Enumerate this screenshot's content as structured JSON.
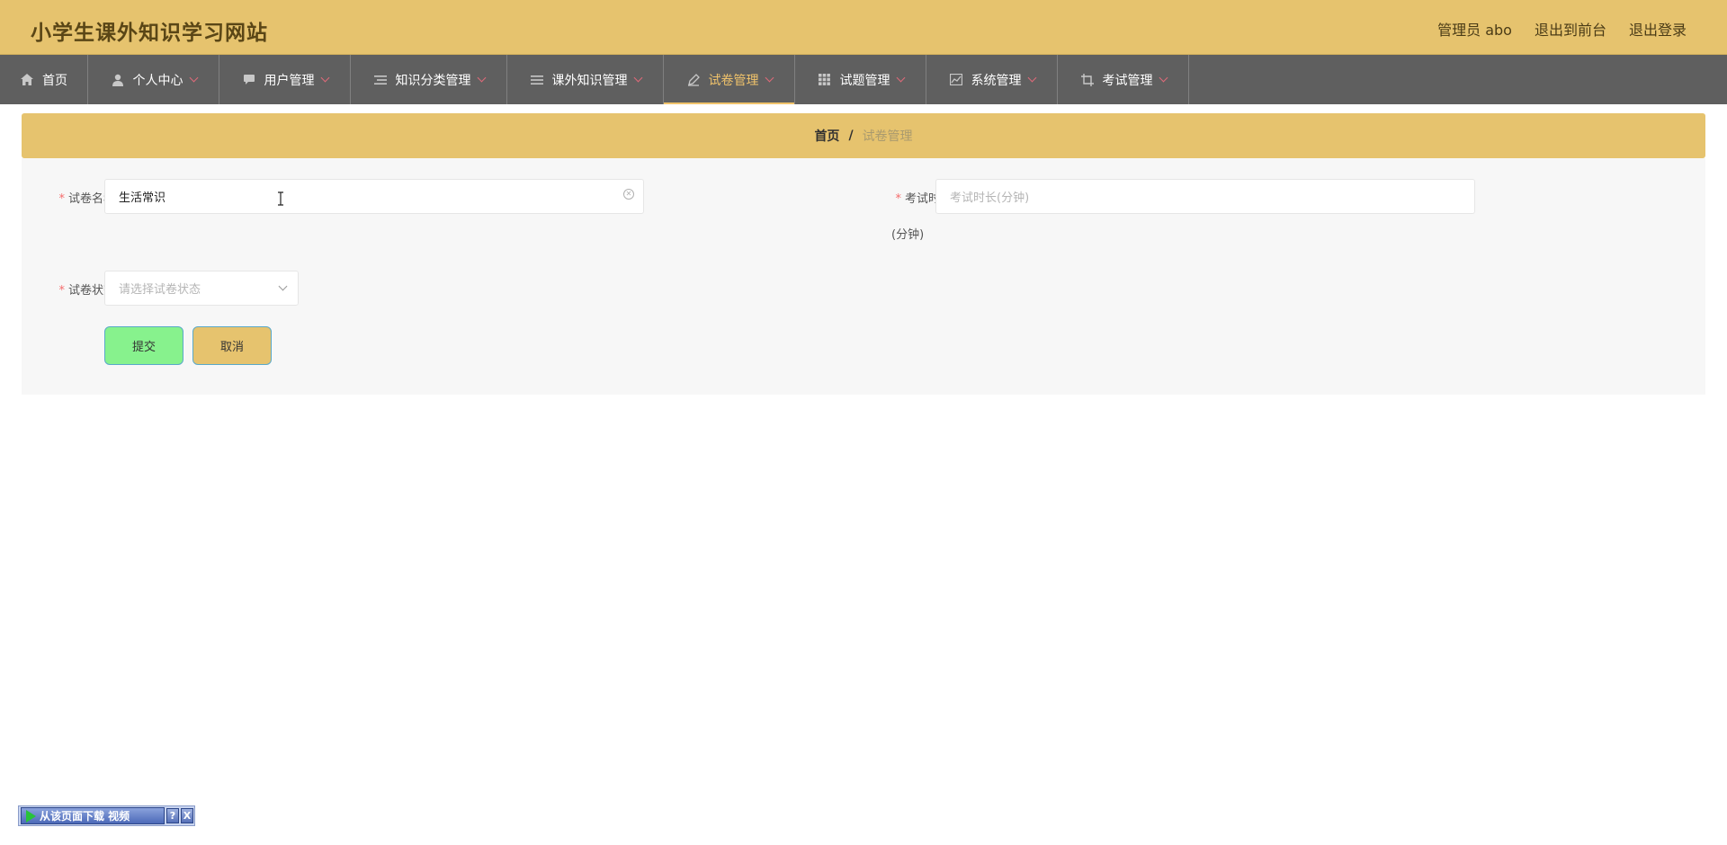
{
  "header": {
    "site_title": "小学生课外知识学习网站",
    "user_label": "管理员 abo",
    "back_front": "退出到前台",
    "logout": "退出登录"
  },
  "nav": {
    "items": [
      {
        "label": "首页",
        "icon": "home-icon"
      },
      {
        "label": "个人中心",
        "icon": "user-icon"
      },
      {
        "label": "用户管理",
        "icon": "chat-icon"
      },
      {
        "label": "知识分类管理",
        "icon": "list-icon"
      },
      {
        "label": "课外知识管理",
        "icon": "menu-icon"
      },
      {
        "label": "试卷管理",
        "icon": "pen-icon",
        "active": true
      },
      {
        "label": "试题管理",
        "icon": "grid-icon"
      },
      {
        "label": "系统管理",
        "icon": "chart-icon"
      },
      {
        "label": "考试管理",
        "icon": "crop-icon"
      }
    ]
  },
  "breadcrumb": {
    "home": "首页",
    "separator": "/",
    "current": "试卷管理"
  },
  "form": {
    "name_label": "试卷名称",
    "name_value": "生活常识",
    "duration_label": "考试时长",
    "duration_placeholder": "考试时长(分钟)",
    "duration_unit": "(分钟)",
    "status_label": "试卷状态",
    "status_placeholder": "请选择试卷状态",
    "required_mark": "*",
    "submit": "提交",
    "cancel": "取消"
  },
  "download_widget": {
    "label": "从该页面下载 视频",
    "help": "?",
    "close": "X"
  },
  "colors": {
    "header_bg": "#e6c36e",
    "nav_bg": "#5f5f5f",
    "nav_active": "#f0c36b",
    "submit_bg": "#87f28d",
    "cancel_bg": "#e6c36e",
    "required": "#f56c6c"
  }
}
